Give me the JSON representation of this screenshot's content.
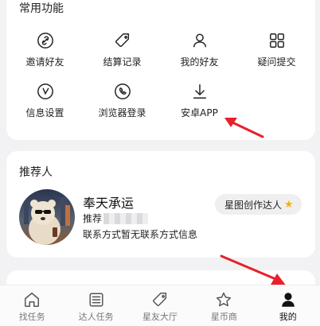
{
  "common_functions": {
    "title": "常用功能",
    "items": [
      {
        "label": "邀请好友",
        "icon": "link-icon"
      },
      {
        "label": "结算记录",
        "icon": "tag-icon"
      },
      {
        "label": "我的好友",
        "icon": "person-icon"
      },
      {
        "label": "疑问提交",
        "icon": "grid-icon"
      },
      {
        "label": "信息设置",
        "icon": "clock-icon"
      },
      {
        "label": "浏览器登录",
        "icon": "phone-icon"
      },
      {
        "label": "安卓APP",
        "icon": "download-icon"
      }
    ]
  },
  "referrer": {
    "title": "推荐人",
    "name": "奉天承运",
    "role_prefix": "推荐",
    "contact": "联系方式暂无联系方式信息",
    "badge": "星图创作达人",
    "badge_icon": "star-icon"
  },
  "tabbar": {
    "active_index": 4,
    "tabs": [
      {
        "label": "找任务",
        "icon": "home-icon"
      },
      {
        "label": "达人任务",
        "icon": "list-icon"
      },
      {
        "label": "星友大厅",
        "icon": "tag-icon"
      },
      {
        "label": "星币商",
        "icon": "star-icon"
      },
      {
        "label": "我的",
        "icon": "user-icon"
      }
    ]
  },
  "colors": {
    "accent_red": "#e8202a",
    "background": "#f2f2f4",
    "badge_star": "#f5b400"
  }
}
